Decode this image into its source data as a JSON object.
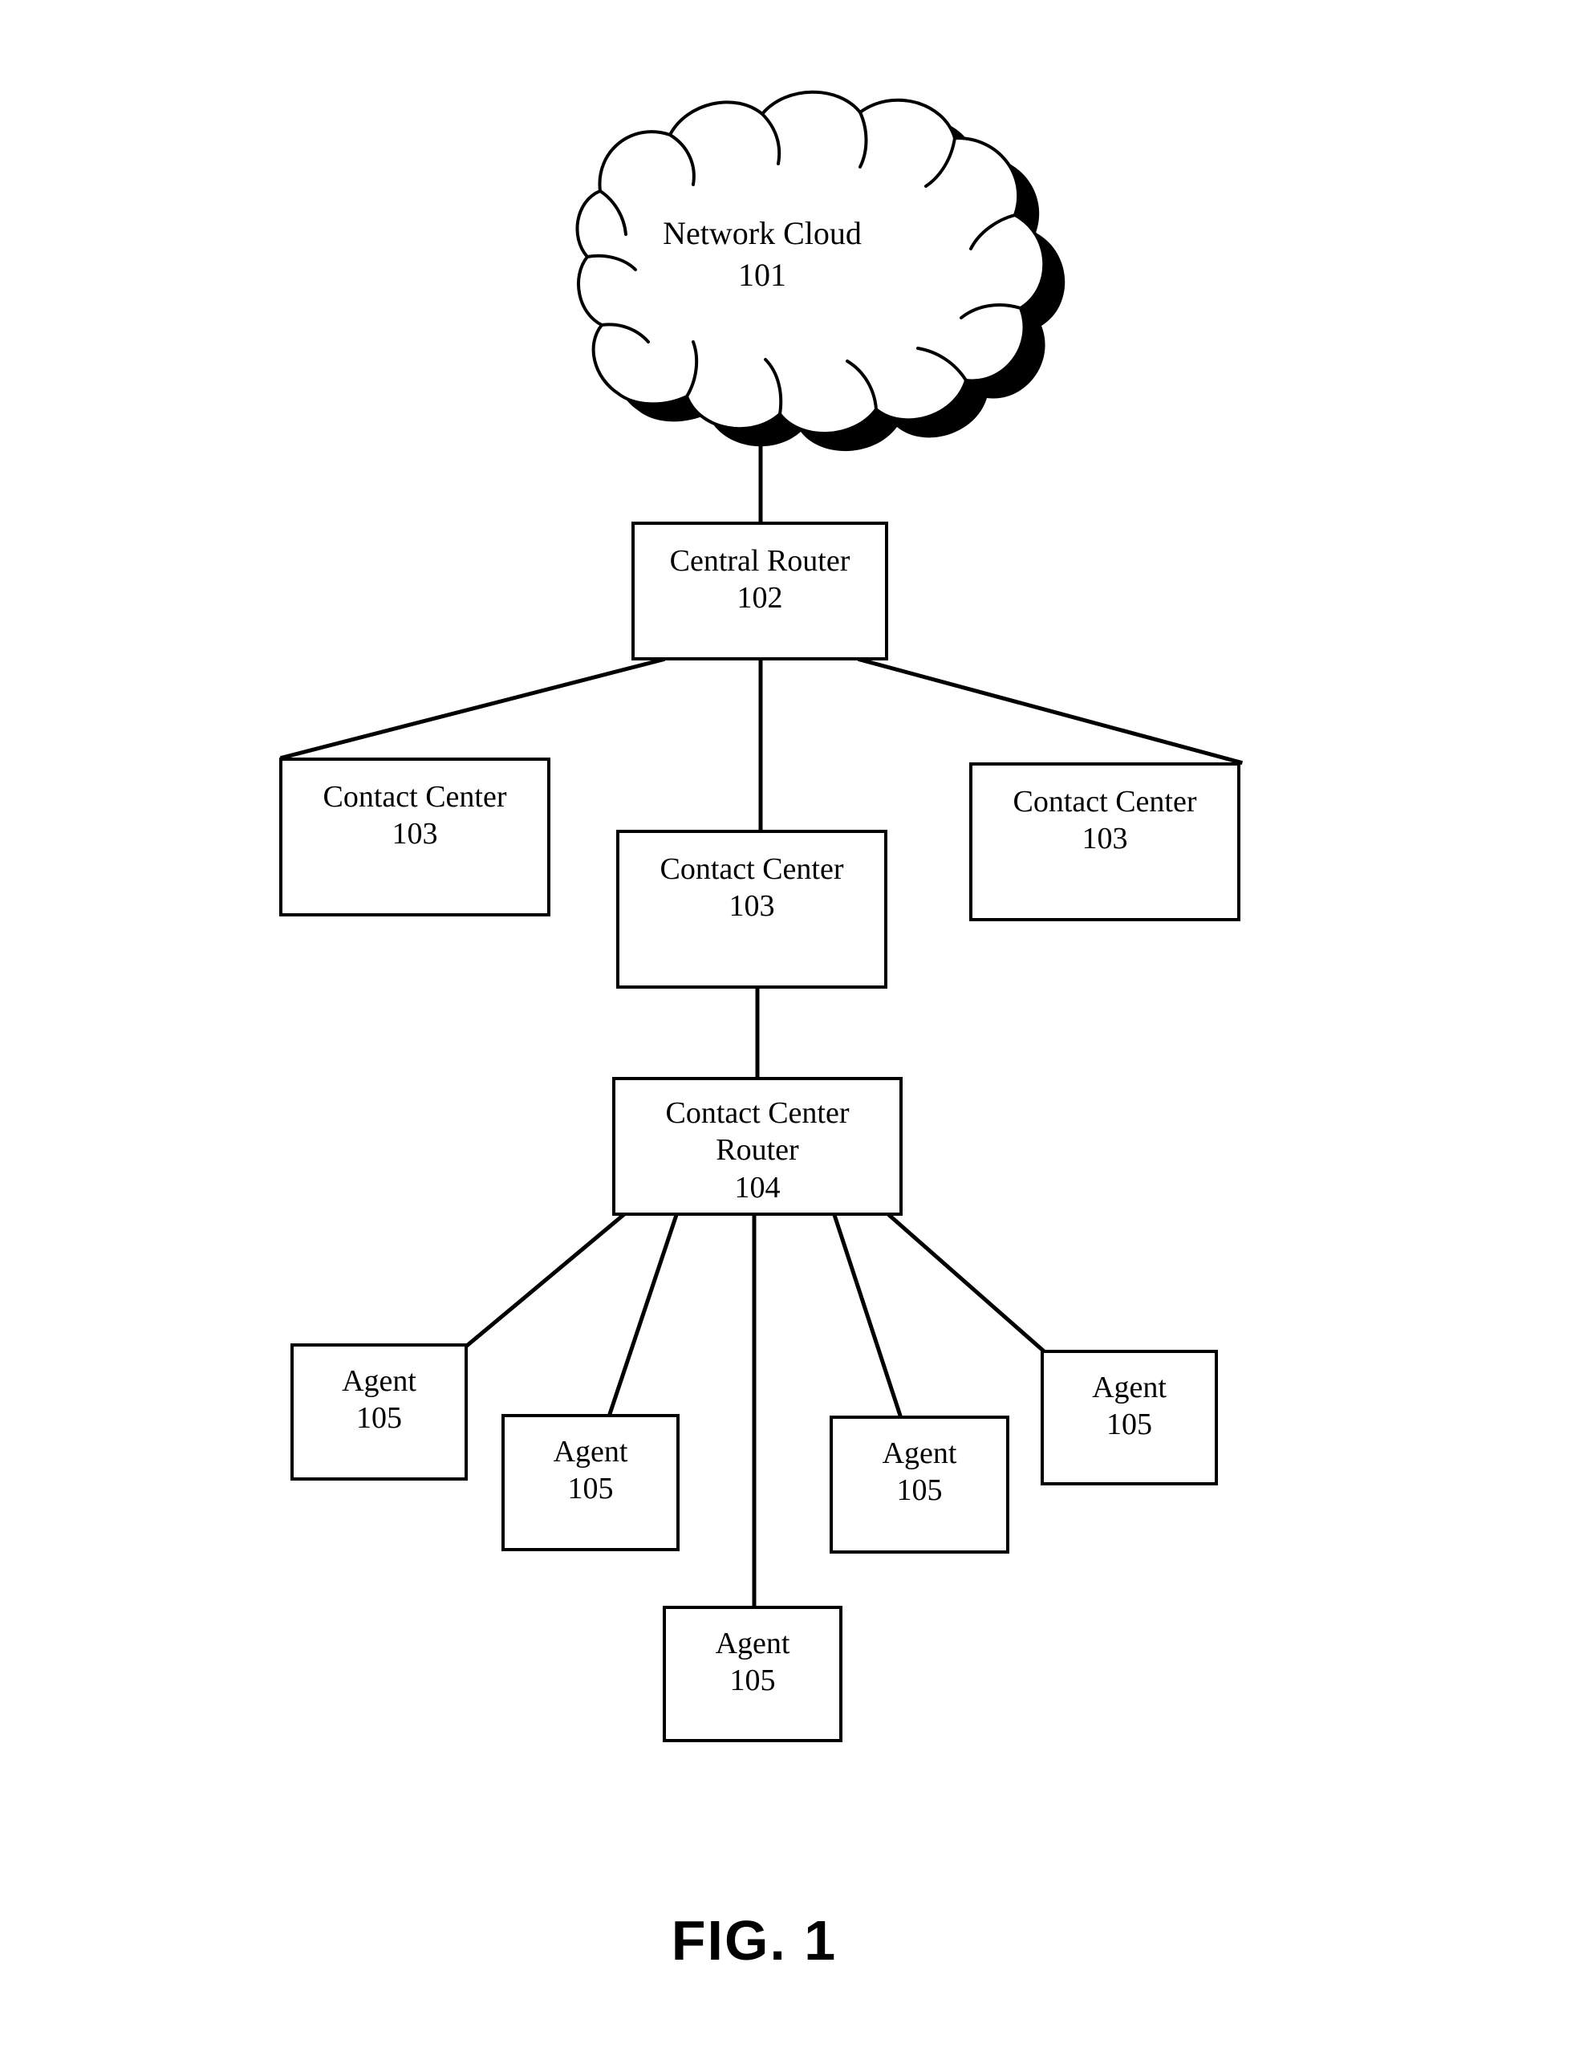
{
  "figure": {
    "caption": "FIG. 1",
    "stroke_color": "#000000",
    "background_color": "#ffffff"
  },
  "nodes": {
    "network_cloud": {
      "icon": "cloud-shape",
      "title": "Network Cloud",
      "ref": "101"
    },
    "central_router": {
      "title": "Central Router",
      "ref": "102"
    },
    "contact_center_left": {
      "title": "Contact Center",
      "ref": "103"
    },
    "contact_center_middle": {
      "title": "Contact Center",
      "ref": "103"
    },
    "contact_center_right": {
      "title": "Contact Center",
      "ref": "103"
    },
    "contact_center_router": {
      "title_line1": "Contact Center",
      "title_line2": "Router",
      "ref": "104"
    },
    "agent_1": {
      "title": "Agent",
      "ref": "105"
    },
    "agent_2": {
      "title": "Agent",
      "ref": "105"
    },
    "agent_3": {
      "title": "Agent",
      "ref": "105"
    },
    "agent_4": {
      "title": "Agent",
      "ref": "105"
    },
    "agent_5": {
      "title": "Agent",
      "ref": "105"
    }
  },
  "chart_data": {
    "type": "diagram",
    "title": "FIG. 1",
    "diagram_kind": "network topology block diagram",
    "nodes": [
      {
        "id": "101",
        "label": "Network Cloud",
        "ref": "101",
        "shape": "cloud"
      },
      {
        "id": "102",
        "label": "Central Router",
        "ref": "102",
        "shape": "rect"
      },
      {
        "id": "103a",
        "label": "Contact Center",
        "ref": "103",
        "shape": "rect"
      },
      {
        "id": "103b",
        "label": "Contact Center",
        "ref": "103",
        "shape": "rect"
      },
      {
        "id": "103c",
        "label": "Contact Center",
        "ref": "103",
        "shape": "rect"
      },
      {
        "id": "104",
        "label": "Contact Center Router",
        "ref": "104",
        "shape": "rect"
      },
      {
        "id": "105a",
        "label": "Agent",
        "ref": "105",
        "shape": "rect"
      },
      {
        "id": "105b",
        "label": "Agent",
        "ref": "105",
        "shape": "rect"
      },
      {
        "id": "105c",
        "label": "Agent",
        "ref": "105",
        "shape": "rect"
      },
      {
        "id": "105d",
        "label": "Agent",
        "ref": "105",
        "shape": "rect"
      },
      {
        "id": "105e",
        "label": "Agent",
        "ref": "105",
        "shape": "rect"
      }
    ],
    "edges": [
      {
        "from": "101",
        "to": "102"
      },
      {
        "from": "102",
        "to": "103a"
      },
      {
        "from": "102",
        "to": "103b"
      },
      {
        "from": "102",
        "to": "103c"
      },
      {
        "from": "103b",
        "to": "104"
      },
      {
        "from": "104",
        "to": "105a"
      },
      {
        "from": "104",
        "to": "105b"
      },
      {
        "from": "104",
        "to": "105c"
      },
      {
        "from": "104",
        "to": "105d"
      },
      {
        "from": "104",
        "to": "105e"
      }
    ]
  }
}
